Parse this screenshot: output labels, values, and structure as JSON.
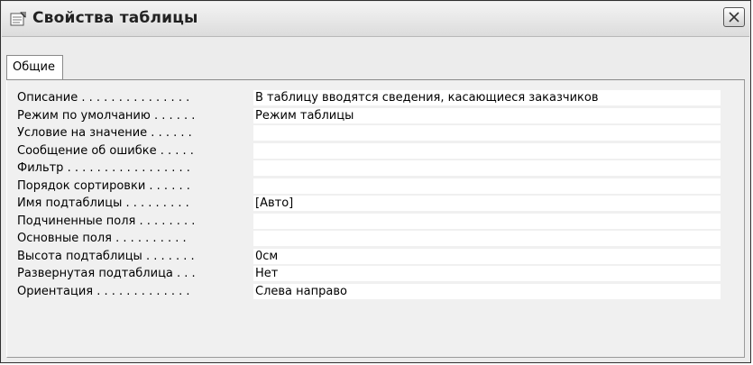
{
  "window": {
    "title": "Свойства таблицы",
    "title_icon": "properties-icon",
    "close_icon": "close-icon"
  },
  "tabs": [
    {
      "label": "Общие",
      "selected": true
    }
  ],
  "properties": [
    {
      "label": "Описание . . . . . . . . . . . . . . .",
      "value": "В таблицу вводятся сведения, касающиеся заказчиков"
    },
    {
      "label": "Режим по умолчанию . . . . . .",
      "value": "Режим таблицы"
    },
    {
      "label": "Условие на значение . . . . . .",
      "value": ""
    },
    {
      "label": "Сообщение об ошибке . . . . .",
      "value": ""
    },
    {
      "label": "Фильтр . . . . . . . . . . . . . . . . .",
      "value": ""
    },
    {
      "label": "Порядок сортировки . . . . . .",
      "value": ""
    },
    {
      "label": "Имя подтаблицы . . . . . . . . .",
      "value": "[Авто]"
    },
    {
      "label": "Подчиненные поля . . . . . . . .",
      "value": ""
    },
    {
      "label": "Основные поля . . . . . . . . . .",
      "value": ""
    },
    {
      "label": "Высота подтаблицы . . . . . . .",
      "value": "0см"
    },
    {
      "label": "Развернутая подтаблица . . .",
      "value": "Нет"
    },
    {
      "label": "Ориентация . . . . . . . . . . . . .",
      "value": "Слева направо"
    }
  ],
  "colors": {
    "window_bg": "#ececec",
    "field_bg": "#ffffff",
    "text": "#000000"
  }
}
